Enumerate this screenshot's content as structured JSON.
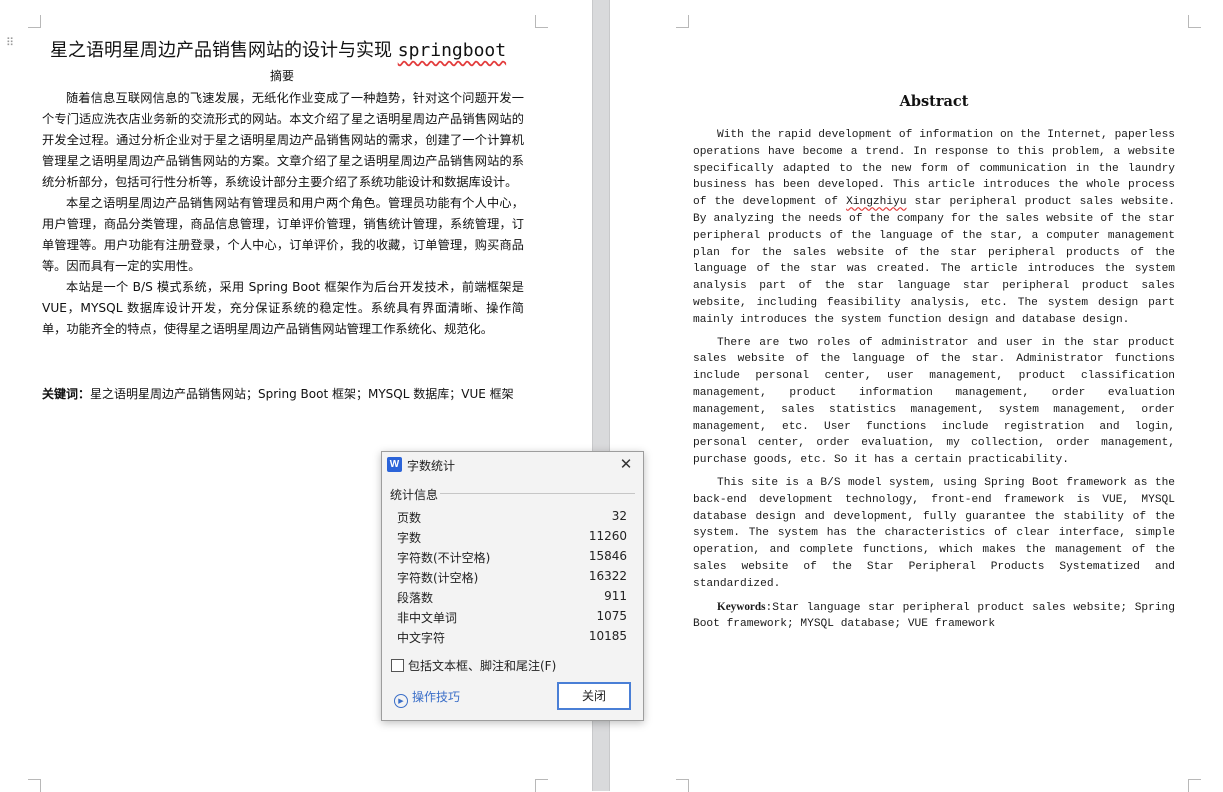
{
  "left_page": {
    "title_cn": "星之语明星周边产品销售网站的设计与实现",
    "title_en": "springboot",
    "abstract_heading": "摘要",
    "paragraphs": [
      "随着信息互联网信息的飞速发展，无纸化作业变成了一种趋势，针对这个问题开发一个专门适应洗衣店业务新的交流形式的网站。本文介绍了星之语明星周边产品销售网站的开发全过程。通过分析企业对于星之语明星周边产品销售网站的需求，创建了一个计算机管理星之语明星周边产品销售网站的方案。文章介绍了星之语明星周边产品销售网站的系统分析部分，包括可行性分析等，系统设计部分主要介绍了系统功能设计和数据库设计。",
      "本星之语明星周边产品销售网站有管理员和用户两个角色。管理员功能有个人中心，用户管理，商品分类管理，商品信息管理，订单评价管理，销售统计管理，系统管理，订单管理等。用户功能有注册登录，个人中心，订单评价，我的收藏，订单管理，购买商品等。因而具有一定的实用性。",
      "本站是一个 B/S 模式系统，采用 Spring Boot 框架作为后台开发技术，前端框架是 VUE，MYSQL 数据库设计开发，充分保证系统的稳定性。系统具有界面清晰、操作简单，功能齐全的特点，使得星之语明星周边产品销售网站管理工作系统化、规范化。"
    ],
    "keywords_label": "关键词：",
    "keywords": "星之语明星周边产品销售网站；Spring Boot 框架；MYSQL 数据库；VUE 框架"
  },
  "right_page": {
    "heading": "Abstract",
    "p1": "With the rapid development of information on the Internet, paperless operations have become a trend. In response to this problem, a website specifically adapted to the new form of communication in the laundry business has been developed. This article introduces the whole process of the development of",
    "p1_squiggle": "Xingzhiyu",
    "p1_rest": " star peripheral product sales website. By analyzing the needs of the company for the sales website of the star peripheral products of the language of the star, a computer management plan for the sales website of the star peripheral products of the language of the star was created. The article introduces the system analysis part of the star language star peripheral product sales website, including feasibility analysis, etc. The system design part mainly introduces the system function design and database design.",
    "p2": "There are two roles of administrator and user in the star product sales website of the language of the star. Administrator functions include personal center, user management, product classification management, product information management, order evaluation management, sales statistics management, system management, order management, etc. User functions include registration and login, personal center, order evaluation, my collection, order management, purchase goods, etc. So it has a certain practicability.",
    "p3": "This site is a B/S model system, using Spring Boot framework as the back-end development technology, front-end framework is VUE, MYSQL database design and development, fully guarantee the stability of the system. The system has the characteristics of clear interface, simple operation, and complete functions, which makes the management of the sales website of the Star Peripheral Products Systematized and standardized.",
    "keywords_label": "Keywords",
    "keywords": ":Star language star peripheral product sales website; Spring Boot framework; MYSQL database; VUE framework"
  },
  "dialog": {
    "icon_letter": "W",
    "title": "字数统计",
    "close_glyph": "✕",
    "group_label": "统计信息",
    "stats": [
      {
        "label": "页数",
        "value": "32"
      },
      {
        "label": "字数",
        "value": "11260"
      },
      {
        "label": "字符数(不计空格)",
        "value": "15846"
      },
      {
        "label": "字符数(计空格)",
        "value": "16322"
      },
      {
        "label": "段落数",
        "value": "911"
      },
      {
        "label": "非中文单词",
        "value": "1075"
      },
      {
        "label": "中文字符",
        "value": "10185"
      }
    ],
    "checkbox_label": "包括文本框、脚注和尾注(F)",
    "checkbox_checked": false,
    "tips_label": "操作技巧",
    "close_button": "关闭"
  },
  "colors": {
    "accent": "#4a7fd6",
    "link": "#3a6ec8",
    "wps_icon": "#2b64d9",
    "spell_squiggle": "#e23b3b",
    "gutter": "#d9dadc"
  }
}
